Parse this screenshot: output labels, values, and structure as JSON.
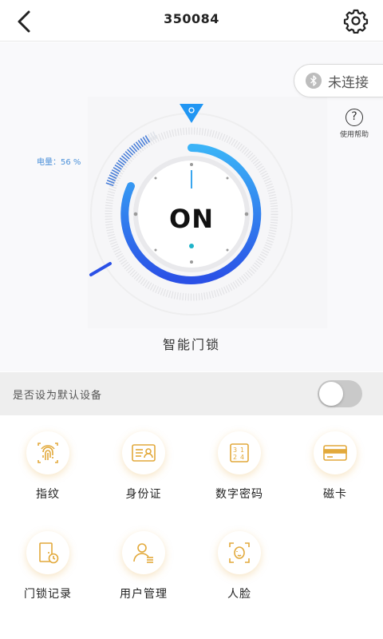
{
  "header": {
    "title": "350084"
  },
  "bluetooth": {
    "status": "未连接"
  },
  "help": {
    "label": "使用帮助"
  },
  "battery": {
    "label": "电量：56 %",
    "level_percent": 56
  },
  "lock": {
    "state": "ON",
    "name": "智能门锁"
  },
  "default_setting": {
    "label": "是否设为默认设备",
    "enabled": false
  },
  "menu": [
    {
      "label": "指纹",
      "icon": "fingerprint-icon"
    },
    {
      "label": "身份证",
      "icon": "id-card-icon"
    },
    {
      "label": "数字密码",
      "icon": "numeric-password-icon"
    },
    {
      "label": "磁卡",
      "icon": "magnetic-card-icon"
    },
    {
      "label": "门锁记录",
      "icon": "door-record-icon"
    },
    {
      "label": "用户管理",
      "icon": "user-management-icon"
    },
    {
      "label": "人脸",
      "icon": "face-icon"
    }
  ],
  "colors": {
    "accent_blue": "#2f6ff0",
    "light_blue": "#35a8f5",
    "icon_gold": "#e2a93b"
  }
}
